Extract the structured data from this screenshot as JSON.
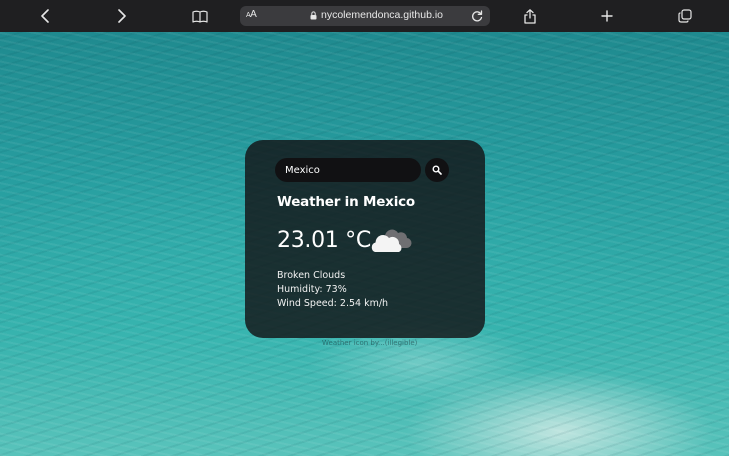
{
  "browser": {
    "text_size_label": "AA",
    "url": "nycolemendonca.github.io"
  },
  "weather": {
    "search_value": "Mexico",
    "city_heading": "Weather in Mexico",
    "temperature": "23.01 °C",
    "description": "Broken Clouds",
    "humidity": "Humidity: 73%",
    "wind": "Wind Speed: 2.54 km/h",
    "icon": "broken-clouds-icon"
  },
  "footer": {
    "credit": "Weather icon by...(illegible)"
  }
}
